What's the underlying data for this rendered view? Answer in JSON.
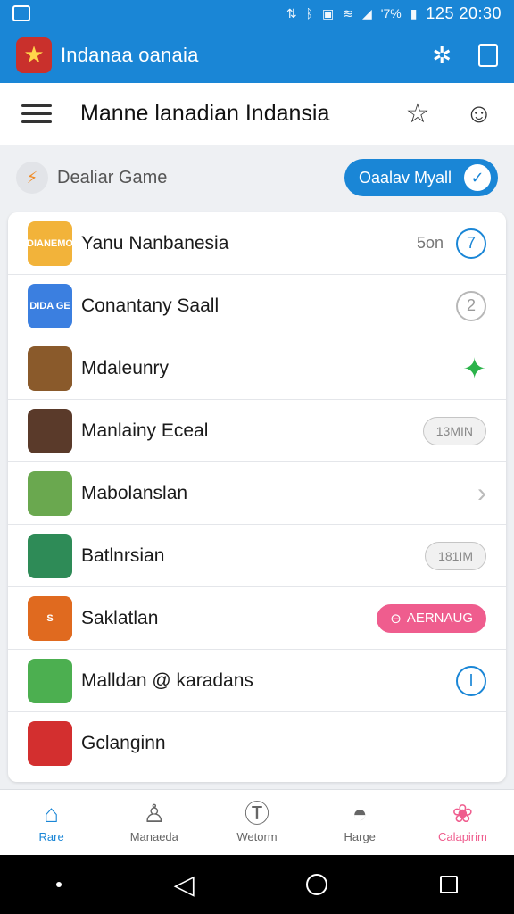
{
  "status_bar": {
    "battery": "'7%",
    "time": "125 20:30"
  },
  "app_bar": {
    "title": "Indanaa oanaia",
    "icons": [
      "app-logo",
      "settings-sparkle-icon",
      "tablet-icon"
    ]
  },
  "title_bar": {
    "title": "Manne lanadian Indansia",
    "icons": [
      "menu-icon",
      "star-icon",
      "smiley-icon"
    ]
  },
  "filter": {
    "label": "Dealiar Game",
    "pill_label": "Oaalav Myall"
  },
  "games": [
    {
      "name": "Yanu Nanbanesia",
      "meta": "5on",
      "trail": "circle",
      "trail_text": "7",
      "icon_color": "#f2b33a",
      "icon_text": "DIANEMO"
    },
    {
      "name": "Conantany Saall",
      "meta": "",
      "trail": "circle-grey",
      "trail_text": "2",
      "icon_color": "#3b7fe0",
      "icon_text": "DIDA GE"
    },
    {
      "name": "Mdaleunry",
      "meta": "",
      "trail": "sparkle",
      "trail_text": "",
      "icon_color": "#8a5a2b",
      "icon_text": ""
    },
    {
      "name": "Manlainy Eceal",
      "meta": "",
      "trail": "badge",
      "trail_text": "13MIN",
      "icon_color": "#5a3a2a",
      "icon_text": ""
    },
    {
      "name": "Mabolanslan",
      "meta": "",
      "trail": "chevron",
      "trail_text": "",
      "icon_color": "#6aa84f",
      "icon_text": ""
    },
    {
      "name": "Batlnrsian",
      "meta": "",
      "trail": "badge",
      "trail_text": "181IM",
      "icon_color": "#2e8b57",
      "icon_text": ""
    },
    {
      "name": "Saklatlan",
      "meta": "",
      "trail": "badge-pink",
      "trail_text": "AERNAUG",
      "icon_color": "#e06a1f",
      "icon_text": "S"
    },
    {
      "name": "Malldan @ karadans",
      "meta": "",
      "trail": "circle",
      "trail_text": "I",
      "icon_color": "#4caf50",
      "icon_text": ""
    },
    {
      "name": "Gclanginn",
      "meta": "",
      "trail": "none",
      "trail_text": "",
      "icon_color": "#d32f2f",
      "icon_text": ""
    }
  ],
  "bottom_nav": [
    {
      "label": "Rare",
      "icon": "home-icon",
      "state": "active"
    },
    {
      "label": "Manaeda",
      "icon": "person-icon",
      "state": ""
    },
    {
      "label": "Wetorm",
      "icon": "t-circle-icon",
      "state": ""
    },
    {
      "label": "Harge",
      "icon": "helmet-icon",
      "state": ""
    },
    {
      "label": "Calapirim",
      "icon": "octopus-icon",
      "state": "pink"
    }
  ],
  "colors": {
    "accent": "#1a86d6",
    "pink": "#ef5d8e",
    "green": "#2bb34a"
  }
}
